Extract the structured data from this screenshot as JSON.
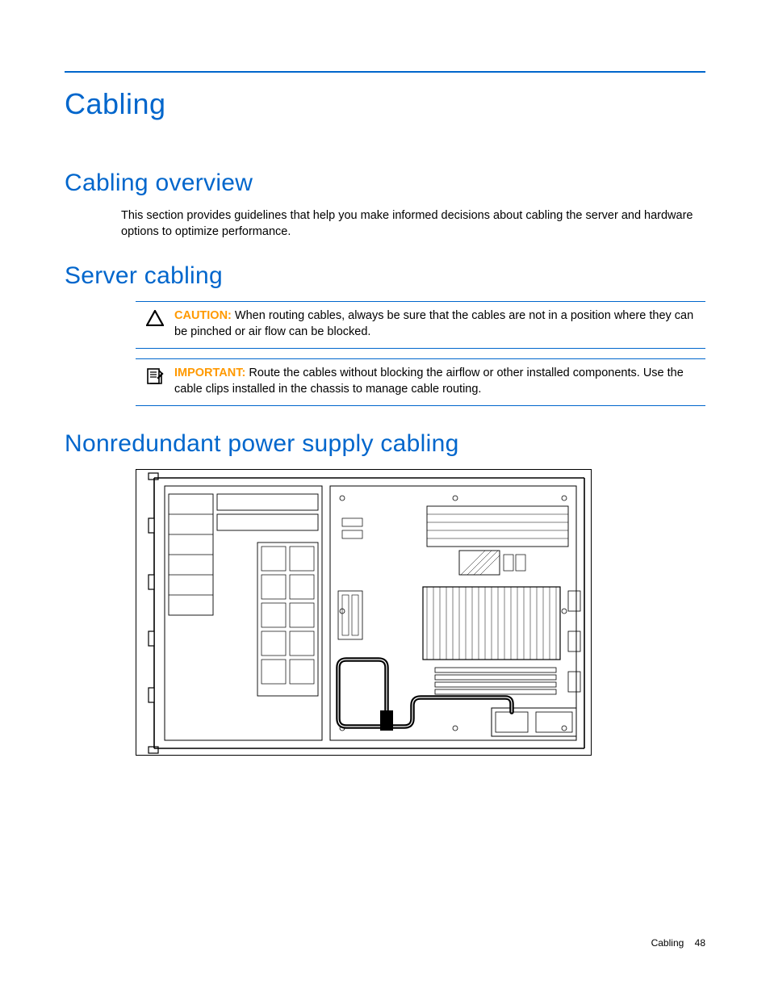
{
  "heading_main": "Cabling",
  "section_overview": {
    "title": "Cabling overview",
    "text": "This section provides guidelines that help you make informed decisions about cabling the server and hardware options to optimize performance."
  },
  "section_server": {
    "title": "Server cabling",
    "caution_label": "CAUTION:",
    "caution_text": "When routing cables, always be sure that the cables are not in a position where they can be pinched or air flow can be blocked.",
    "important_label": "IMPORTANT:",
    "important_text": "Route the cables without blocking the airflow or other installed components. Use the cable clips installed in the chassis to manage cable routing."
  },
  "section_psu": {
    "title": "Nonredundant power supply cabling"
  },
  "footer_label": "Cabling",
  "footer_page": "48"
}
